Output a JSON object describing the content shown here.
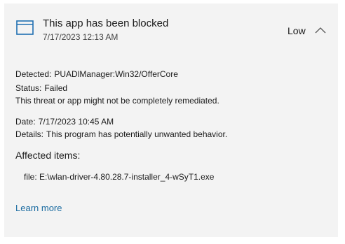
{
  "header": {
    "icon": "app-window-icon",
    "title": "This app has been blocked",
    "timestamp": "7/17/2023 12:13 AM",
    "severity": "Low",
    "toggle_icon": "chevron-up-icon"
  },
  "details": {
    "detected_label": "Detected:",
    "detected_value": "PUADlManager:Win32/OfferCore",
    "status_label": "Status:",
    "status_value": "Failed",
    "status_note": "This threat or app might not be completely remediated.",
    "date_label": "Date:",
    "date_value": "7/17/2023 10:45 AM",
    "details_label": "Details:",
    "details_value": "This program has potentially unwanted behavior."
  },
  "affected": {
    "heading": "Affected items:",
    "items": [
      {
        "label": "file:",
        "value": "E:\\wlan-driver-4.80.28.7-installer_4-wSyT1.exe"
      }
    ]
  },
  "links": {
    "learn_more": "Learn more"
  },
  "colors": {
    "card_background": "#f3f3f3",
    "icon_accent": "#1f6fb2",
    "link": "#1a6ba0"
  }
}
